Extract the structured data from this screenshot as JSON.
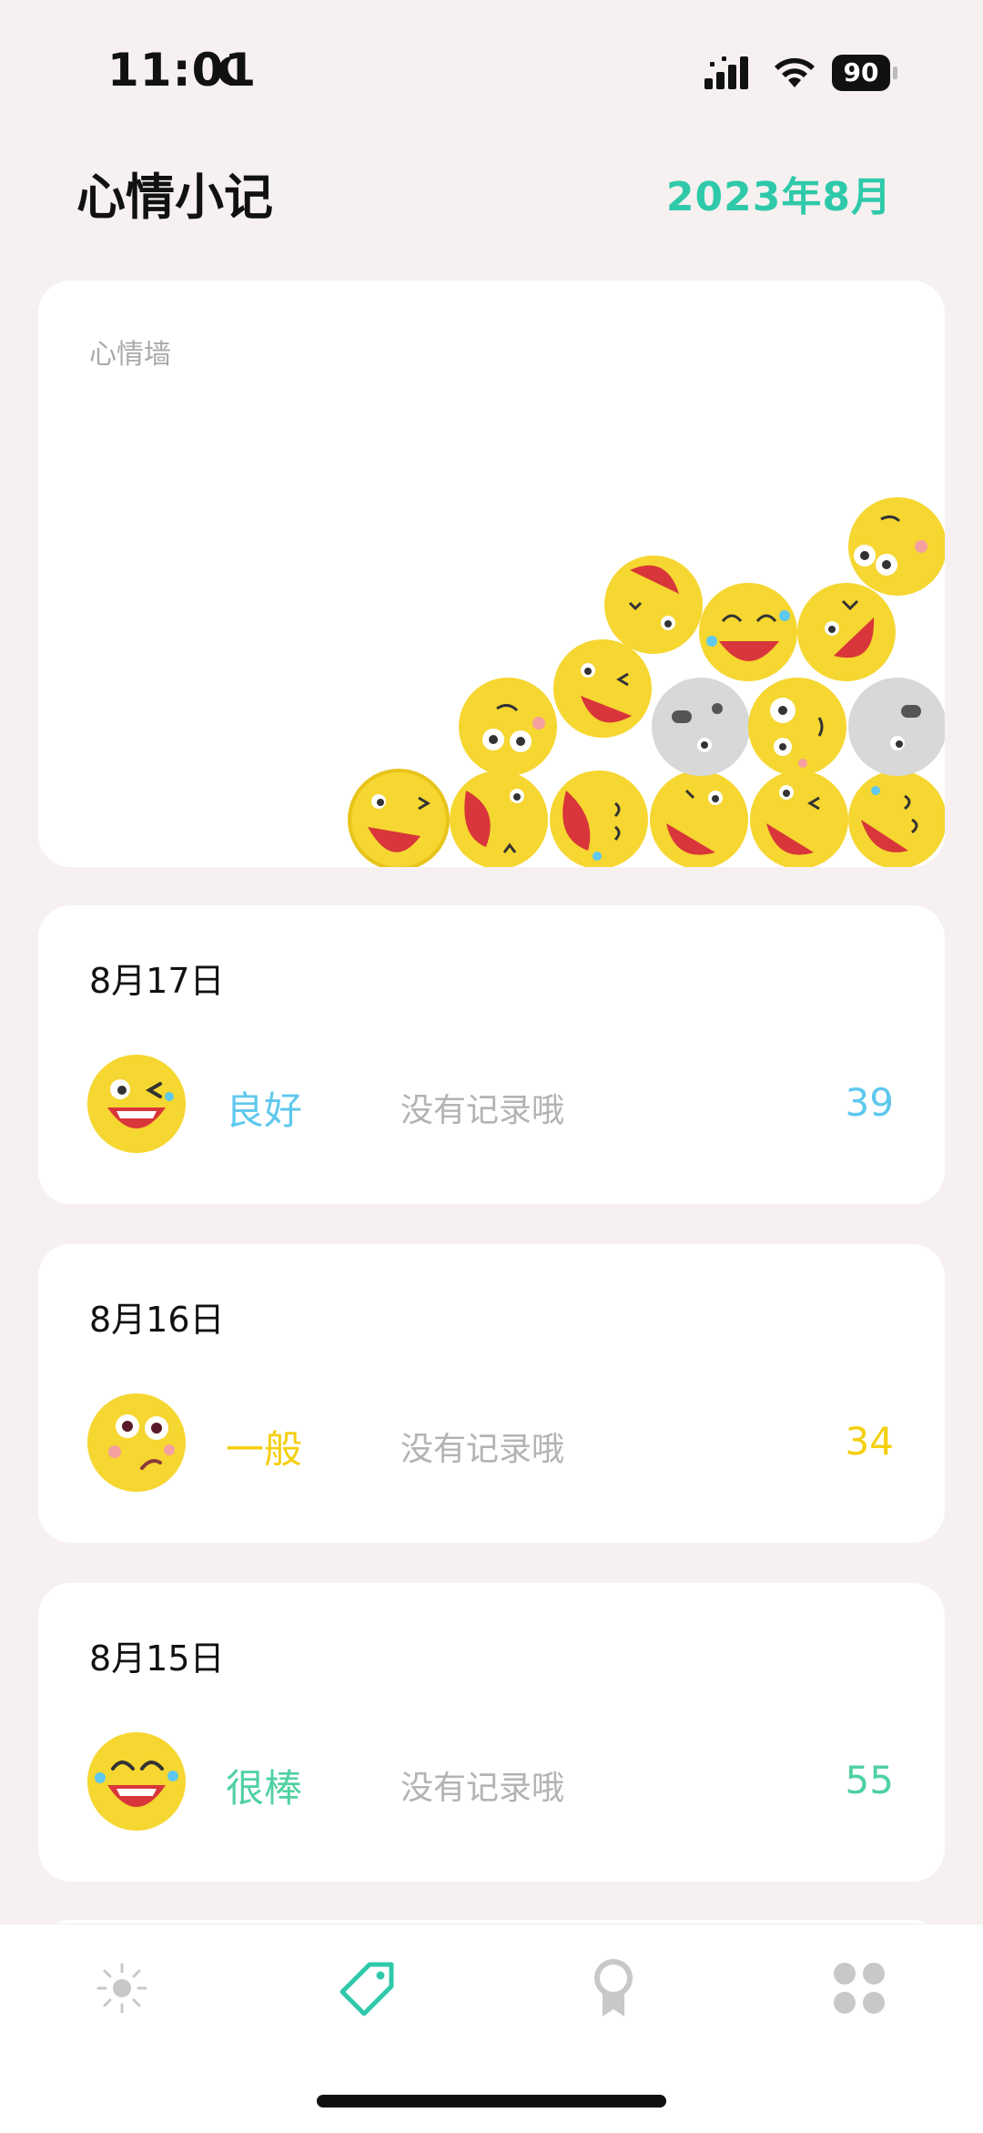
{
  "status_bar": {
    "time": "11:01",
    "battery": "90"
  },
  "header": {
    "title": "心情小记",
    "month": "2023年8月"
  },
  "mood_wall": {
    "label": "心情墙"
  },
  "entries": [
    {
      "date": "8月17日",
      "mood": "良好",
      "note": "没有记录哦",
      "score": "39",
      "color": "#5ec8ee",
      "face": "wink"
    },
    {
      "date": "8月16日",
      "mood": "一般",
      "note": "没有记录哦",
      "score": "34",
      "color": "#f4cf0f",
      "face": "meh"
    },
    {
      "date": "8月15日",
      "mood": "很棒",
      "note": "没有记录哦",
      "score": "55",
      "color": "#4fd1a1",
      "face": "great"
    }
  ],
  "tab_bar": {
    "tabs": [
      {
        "icon": "sun-icon",
        "active": false
      },
      {
        "icon": "tag-icon",
        "active": true
      },
      {
        "icon": "award-icon",
        "active": false
      },
      {
        "icon": "grid-icon",
        "active": false
      }
    ],
    "accent": "#2fc9aa"
  }
}
